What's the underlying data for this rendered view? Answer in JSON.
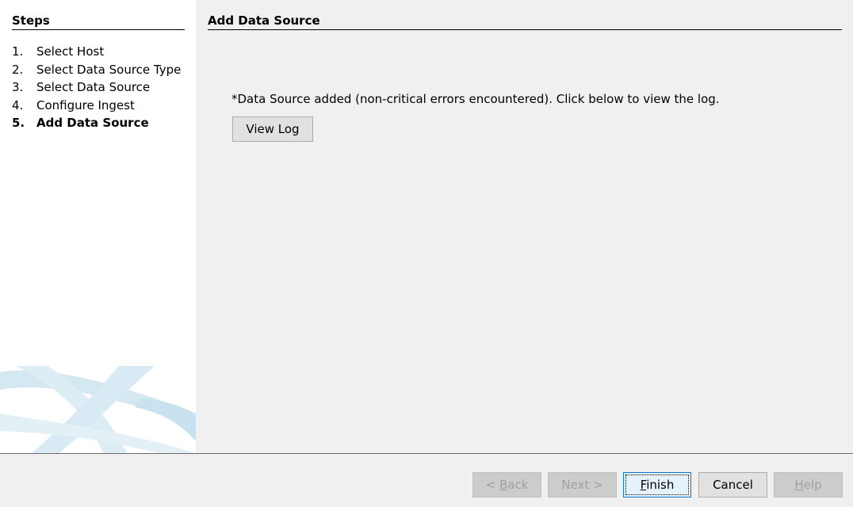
{
  "steps": {
    "title": "Steps",
    "items": [
      {
        "num": "1.",
        "label": "Select Host",
        "active": false
      },
      {
        "num": "2.",
        "label": "Select Data Source Type",
        "active": false
      },
      {
        "num": "3.",
        "label": "Select Data Source",
        "active": false
      },
      {
        "num": "4.",
        "label": "Configure Ingest",
        "active": false
      },
      {
        "num": "5.",
        "label": "Add Data Source",
        "active": true
      }
    ]
  },
  "main": {
    "title": "Add Data Source",
    "status_message": "*Data Source added (non-critical errors encountered). Click below to view the log.",
    "view_log_label": "View Log"
  },
  "footer": {
    "back": {
      "prefix": "< ",
      "mnemonic": "B",
      "rest": "ack",
      "enabled": false
    },
    "next": {
      "label": "Next >",
      "enabled": false
    },
    "finish": {
      "mnemonic": "F",
      "rest": "inish",
      "enabled": true,
      "focused": true
    },
    "cancel": {
      "label": "Cancel",
      "enabled": true
    },
    "help": {
      "mnemonic": "H",
      "rest": "elp",
      "enabled": false
    }
  },
  "colors": {
    "panel_bg": "#ffffff",
    "window_bg": "#f0f0f0",
    "swoosh": "#cfe6f1",
    "focus_border": "#0078d7"
  }
}
